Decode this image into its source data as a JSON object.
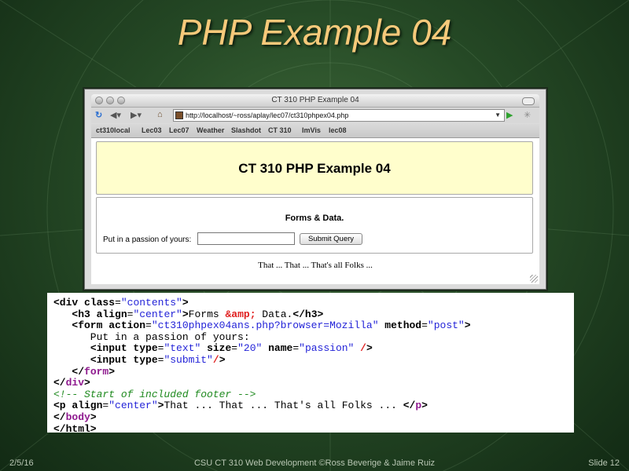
{
  "slide": {
    "title": "PHP Example 04",
    "footer_date": "2/5/16",
    "footer_center": "CSU CT 310 Web Development ©Ross Beverige & Jaime Ruiz",
    "footer_slide": "Slide 12"
  },
  "browser": {
    "window_title": "CT 310 PHP Example 04",
    "url": "http://localhost/~ross/aplay/lec07/ct310phpex04.php",
    "bookmarks": [
      "ct310local",
      "Lec03",
      "Lec07",
      "Weather",
      "Slashdot",
      "CT 310",
      "ImVis",
      "lec08"
    ]
  },
  "page": {
    "header": "CT 310 PHP Example 04",
    "forms_heading": "Forms & Data.",
    "input_label": "Put in a passion of yours:",
    "input_value": "",
    "submit_label": "Submit Query",
    "footer": "That ... That ... That's all Folks ..."
  },
  "code": {
    "line1": "<div class=\"contents\">",
    "line2": "<h3 align=\"center\">Forms &amp; Data.</h3>",
    "line3": "<form action=\"ct310phpex04ans.php?browser=Mozilla\" method=\"post\">",
    "line4": "Put in a passion of yours:",
    "line5": "<input type=\"text\" size=\"20\" name=\"passion\" />",
    "line6": "<input type=\"submit\"/>",
    "line7": "</form>",
    "line8": "</div>",
    "line9": "<!-- Start of included footer -->",
    "line10": "<p align=\"center\">That ... That ... That's all Folks ... </p>",
    "line11": "</body>",
    "line12": "</html>"
  },
  "colors": {
    "title": "#f6c97a",
    "page_header_bg": "#fffecc",
    "code_string": "#2323d8",
    "code_comment": "#1f8a1f"
  }
}
